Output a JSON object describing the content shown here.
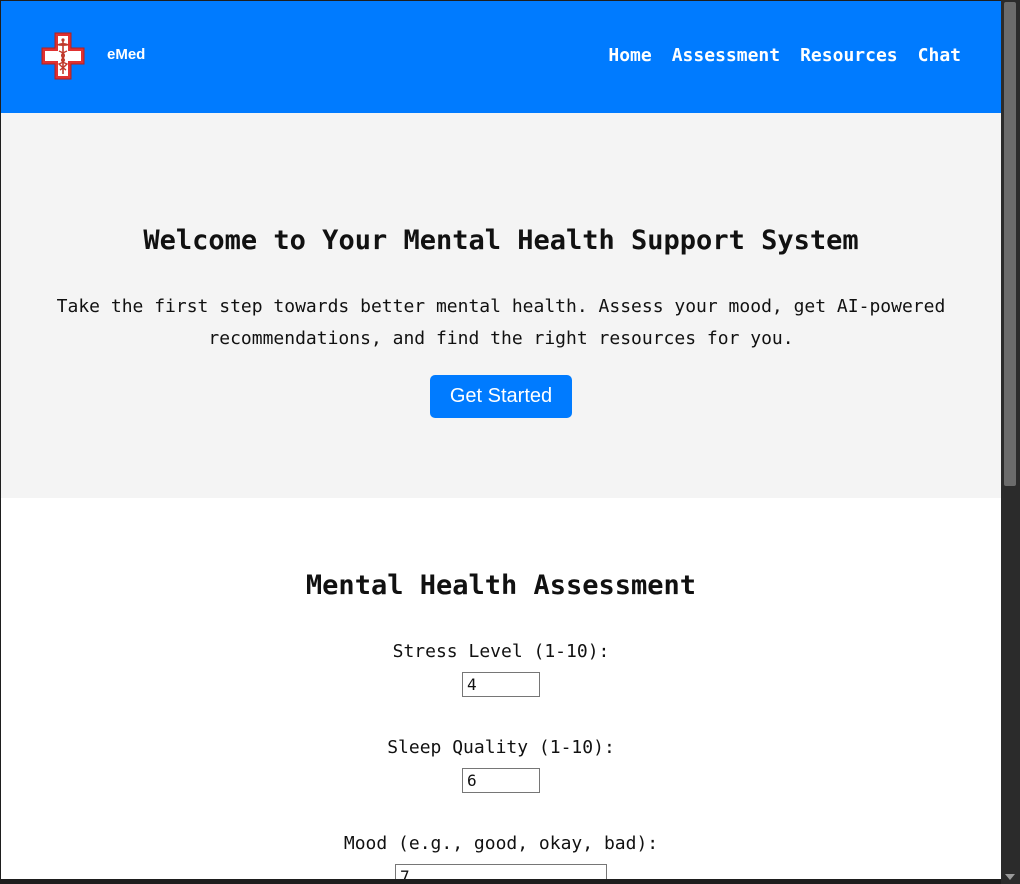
{
  "header": {
    "brand": "eMed",
    "logo_icon": "medical-cross-caduceus-icon",
    "nav": [
      "Home",
      "Assessment",
      "Resources",
      "Chat"
    ]
  },
  "hero": {
    "title": "Welcome to Your Mental Health Support System",
    "description": "Take the first step towards better mental health. Assess your mood, get AI-powered recommendations, and find the right resources for you.",
    "cta_label": "Get Started"
  },
  "assessment": {
    "title": "Mental Health Assessment",
    "fields": [
      {
        "label": "Stress Level (1-10):",
        "value": "4"
      },
      {
        "label": "Sleep Quality (1-10):",
        "value": "6"
      },
      {
        "label": "Mood (e.g., good, okay, bad):",
        "value": "7"
      }
    ]
  },
  "colors": {
    "primary": "#007bff",
    "hero_bg": "#f4f4f4",
    "logo_red": "#e03131"
  }
}
